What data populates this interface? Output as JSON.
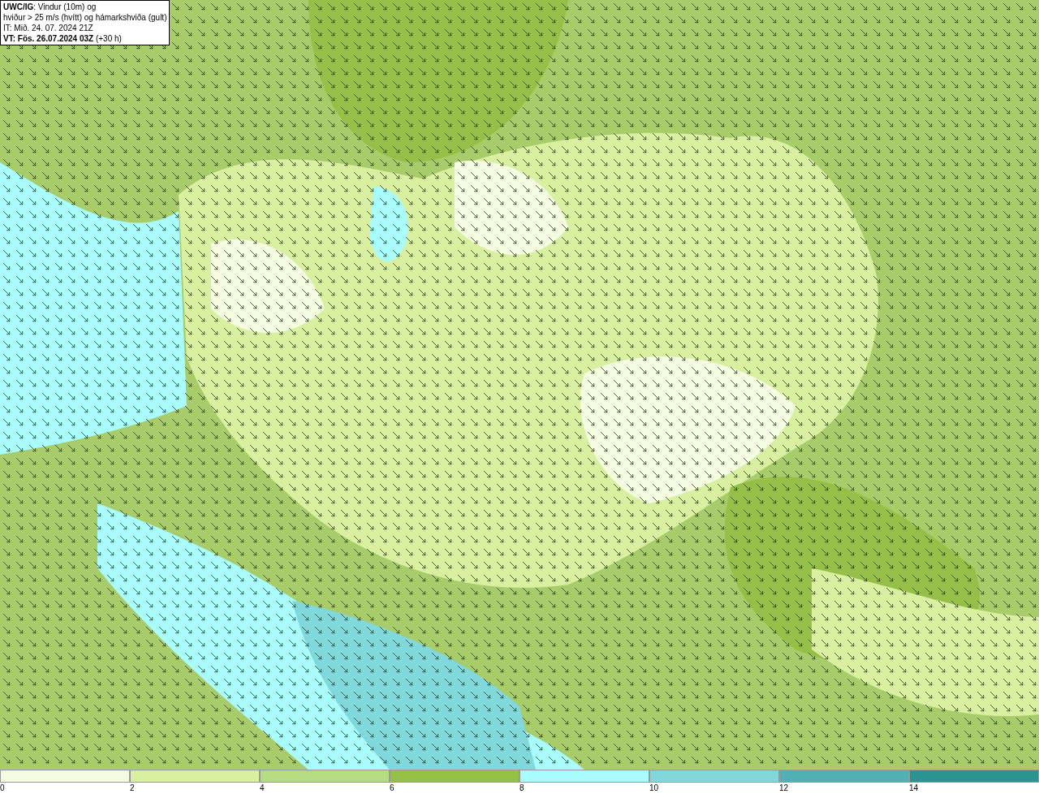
{
  "info_box": {
    "lines": [
      "**UWC/IG**: Vindur (10m) og",
      "hviður > 25 m/s (hvítt) og hámarkshviða (gult)",
      "IT: Mið. 24. 07. 2024 21Z",
      "**VT: Fös. 26.07.2024 03Z** (+30 h)"
    ]
  },
  "legend": [
    {
      "label": "0",
      "color": "#f5fbe0"
    },
    {
      "label": "2",
      "color": "#d8f0a0"
    },
    {
      "label": "4",
      "color": "#b5dc80"
    },
    {
      "label": "6",
      "color": "#96bf48"
    },
    {
      "label": "8",
      "color": "#a8fcfc"
    },
    {
      "label": "10",
      "color": "#80d8dc"
    },
    {
      "label": "12",
      "color": "#50b0b4"
    },
    {
      "label": "14",
      "color": "#2a9490"
    }
  ]
}
